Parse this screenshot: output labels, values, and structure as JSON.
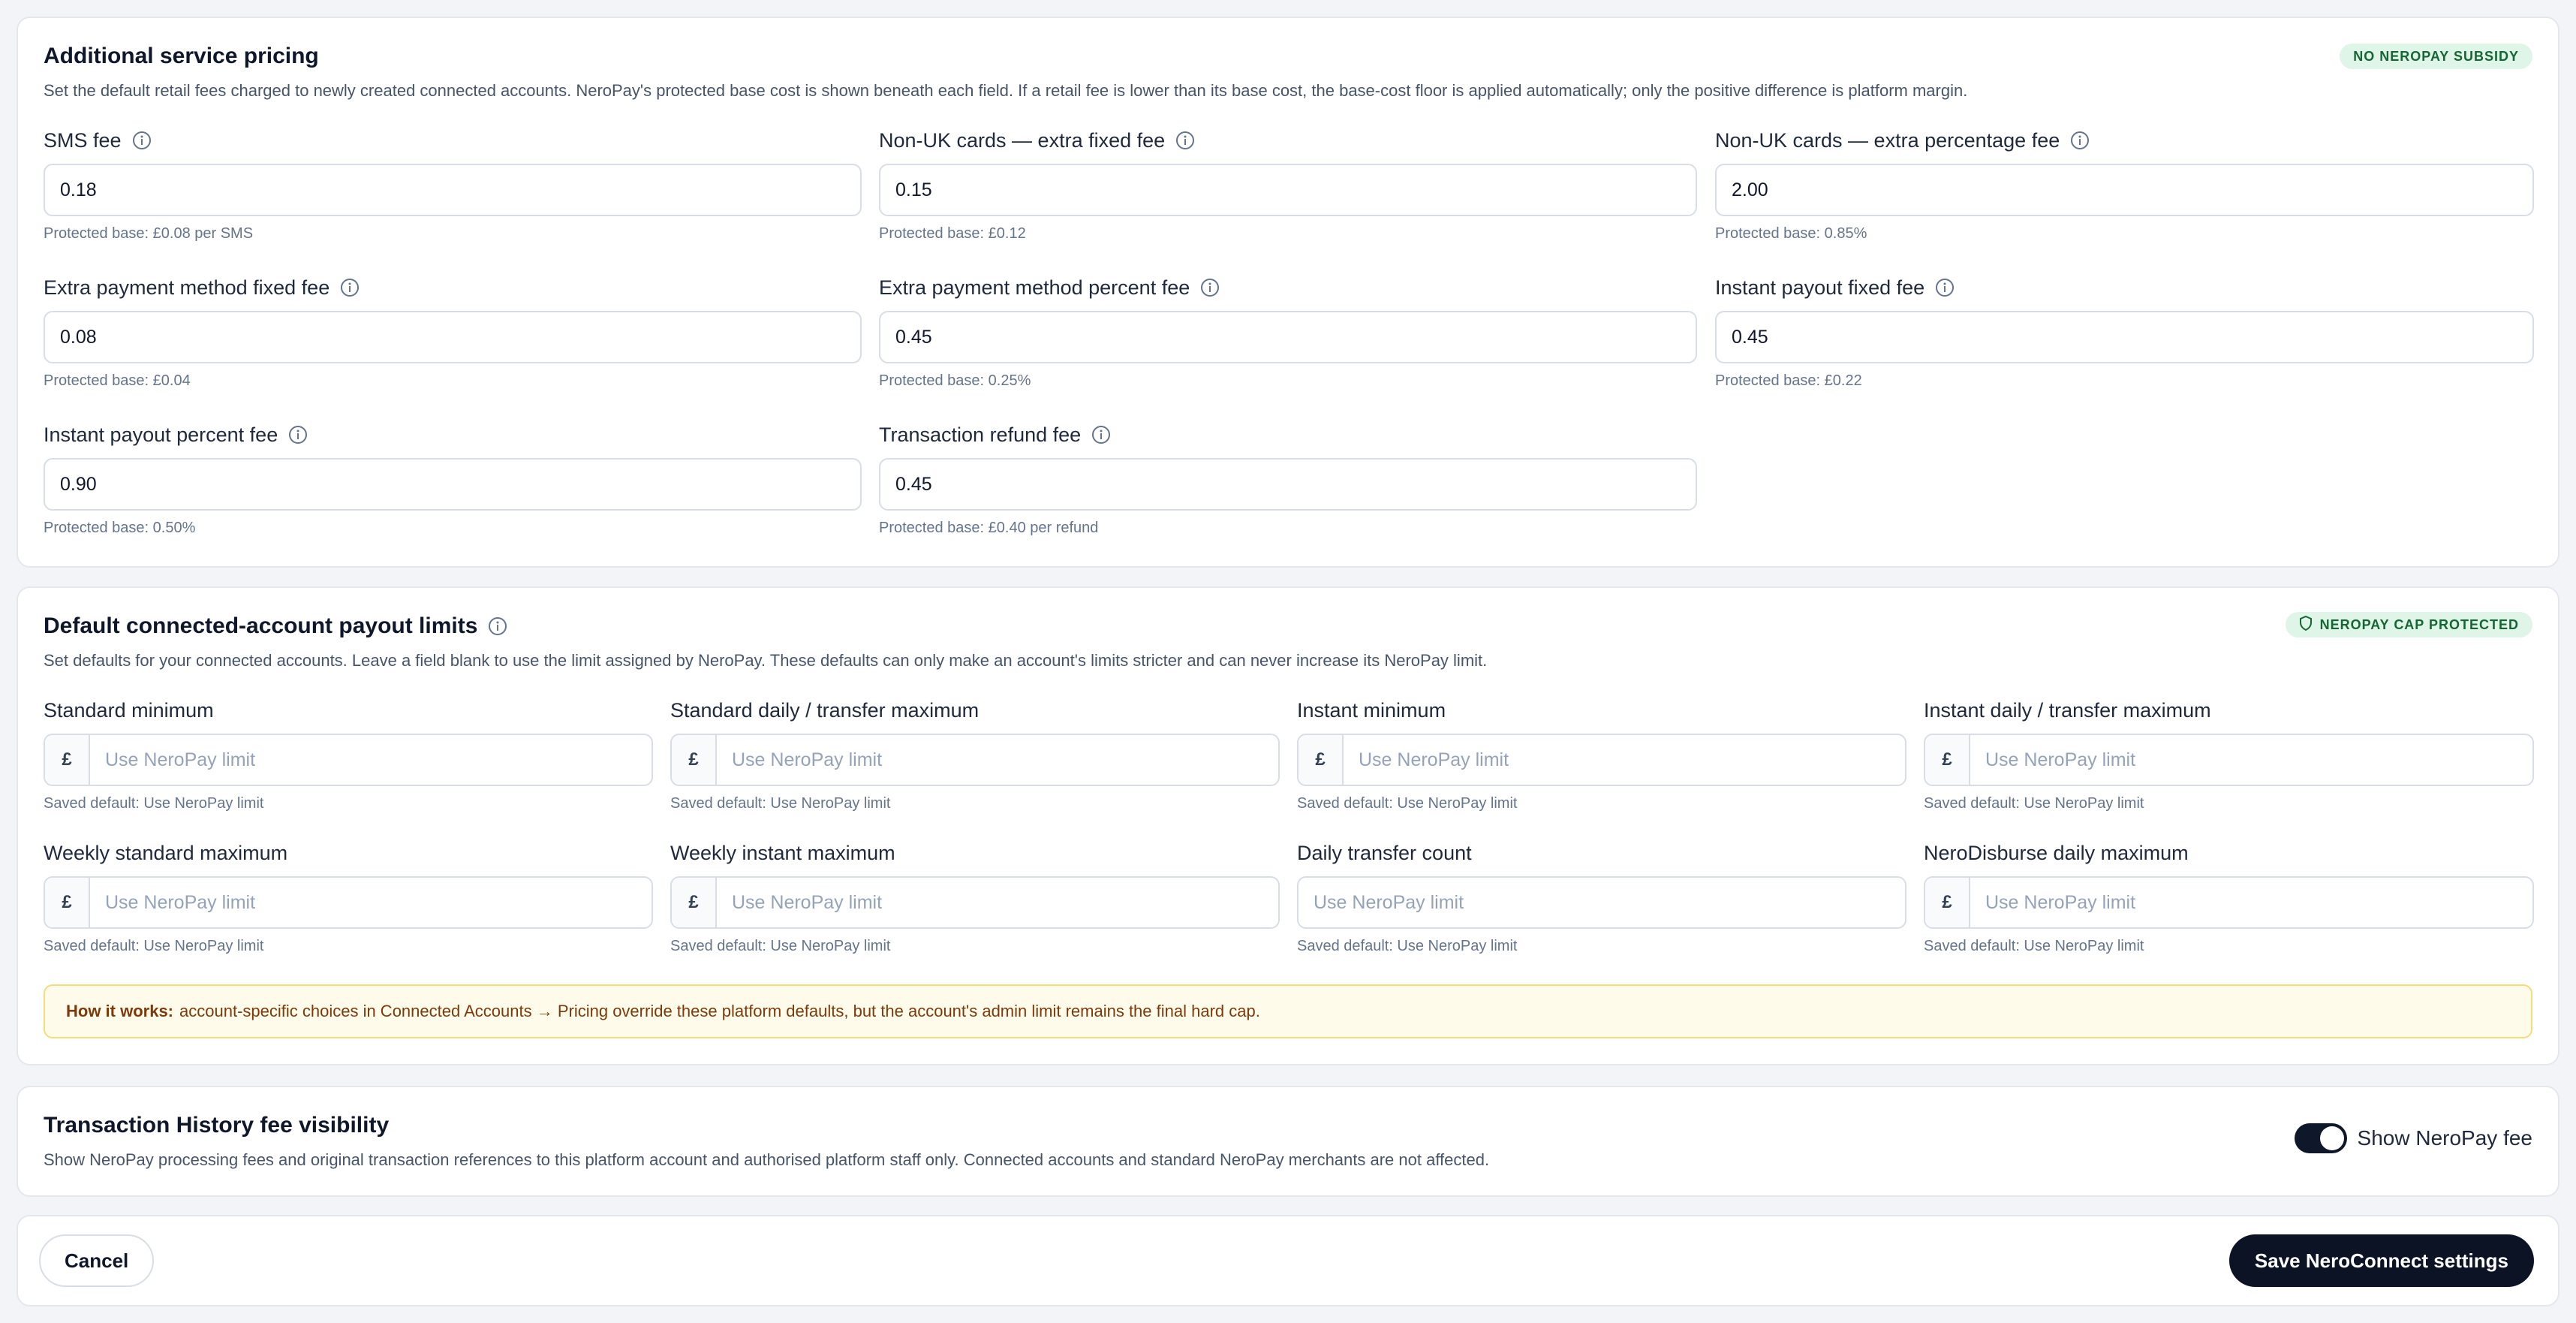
{
  "pricing": {
    "title": "Additional service pricing",
    "badge": "NO NEROPAY SUBSIDY",
    "description": "Set the default retail fees charged to newly created connected accounts. NeroPay's protected base cost is shown beneath each field. If a retail fee is lower than its base cost, the base-cost floor is applied automatically; only the positive difference is platform margin.",
    "fields": [
      {
        "label": "SMS fee",
        "value": "0.18",
        "hint": "Protected base: £0.08 per SMS"
      },
      {
        "label": "Non-UK cards — extra fixed fee",
        "value": "0.15",
        "hint": "Protected base: £0.12"
      },
      {
        "label": "Non-UK cards — extra percentage fee",
        "value": "2.00",
        "hint": "Protected base: 0.85%"
      },
      {
        "label": "Extra payment method fixed fee",
        "value": "0.08",
        "hint": "Protected base: £0.04"
      },
      {
        "label": "Extra payment method percent fee",
        "value": "0.45",
        "hint": "Protected base: 0.25%"
      },
      {
        "label": "Instant payout fixed fee",
        "value": "0.45",
        "hint": "Protected base: £0.22"
      },
      {
        "label": "Instant payout percent fee",
        "value": "0.90",
        "hint": "Protected base: 0.50%"
      },
      {
        "label": "Transaction refund fee",
        "value": "0.45",
        "hint": "Protected base: £0.40 per refund"
      }
    ]
  },
  "limits": {
    "title": "Default connected-account payout limits",
    "badge": "NEROPAY CAP PROTECTED",
    "description": "Set defaults for your connected accounts. Leave a field blank to use the limit assigned by NeroPay. These defaults can only make an account's limits stricter and can never increase its NeroPay limit.",
    "currency_symbol": "£",
    "fields": [
      {
        "label": "Standard minimum",
        "placeholder": "Use NeroPay limit",
        "hint": "Saved default: Use NeroPay limit"
      },
      {
        "label": "Standard daily / transfer maximum",
        "placeholder": "Use NeroPay limit",
        "hint": "Saved default: Use NeroPay limit"
      },
      {
        "label": "Instant minimum",
        "placeholder": "Use NeroPay limit",
        "hint": "Saved default: Use NeroPay limit"
      },
      {
        "label": "Instant daily / transfer maximum",
        "placeholder": "Use NeroPay limit",
        "hint": "Saved default: Use NeroPay limit"
      },
      {
        "label": "Weekly standard maximum",
        "placeholder": "Use NeroPay limit",
        "hint": "Saved default: Use NeroPay limit"
      },
      {
        "label": "Weekly instant maximum",
        "placeholder": "Use NeroPay limit",
        "hint": "Saved default: Use NeroPay limit"
      },
      {
        "label": "Daily transfer count",
        "placeholder": "Use NeroPay limit",
        "hint": "Saved default: Use NeroPay limit"
      },
      {
        "label": "NeroDisburse daily maximum",
        "placeholder": "Use NeroPay limit",
        "hint": "Saved default: Use NeroPay limit"
      }
    ],
    "notice_bold": "How it works:",
    "notice_text": "account-specific choices in Connected Accounts → Pricing override these platform defaults, but the account's admin limit remains the final hard cap."
  },
  "visibility": {
    "title": "Transaction History fee visibility",
    "description": "Show NeroPay processing fees and original transaction references to this platform account and authorised platform staff only. Connected accounts and standard NeroPay merchants are not affected.",
    "toggle_label": "Show NeroPay fee",
    "toggle_on": true
  },
  "footer": {
    "cancel_label": "Cancel",
    "save_label": "Save NeroConnect settings"
  },
  "colors": {
    "badge_bg": "#dff5e7",
    "badge_text": "#166534",
    "primary": "#0b1324",
    "notice_bg": "#fffbea"
  }
}
